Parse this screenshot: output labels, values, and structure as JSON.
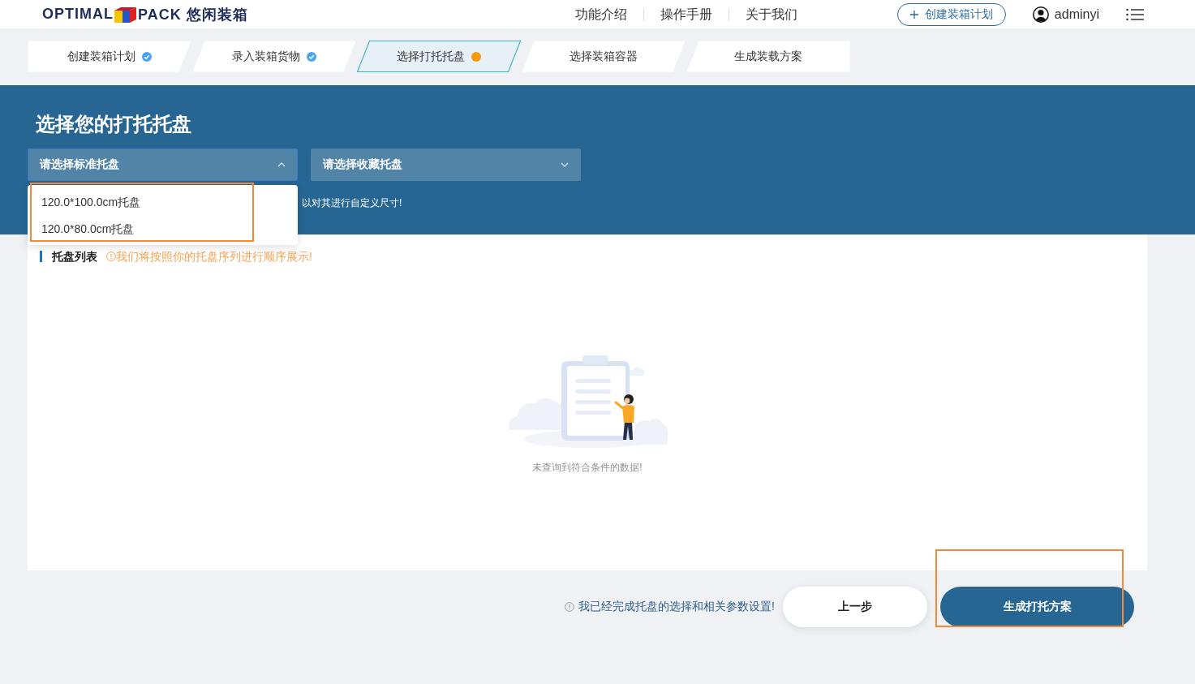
{
  "header": {
    "logo": {
      "left": "OPTIMAL",
      "right": "PACK",
      "name": "悠闲装箱"
    },
    "nav": [
      {
        "label": "功能介绍"
      },
      {
        "label": "操作手册"
      },
      {
        "label": "关于我们"
      }
    ],
    "create_button": "创建装箱计划",
    "user": "adminyi"
  },
  "steps": [
    {
      "label": "创建装箱计划",
      "done": true,
      "current": false,
      "selected": false
    },
    {
      "label": "录入装箱货物",
      "done": true,
      "current": false,
      "selected": false
    },
    {
      "label": "选择打托托盘",
      "done": false,
      "current": true,
      "selected": true
    },
    {
      "label": "选择装箱容器",
      "done": false,
      "current": false,
      "selected": false
    },
    {
      "label": "生成装载方案",
      "done": false,
      "current": false,
      "selected": false
    }
  ],
  "panel": {
    "title": "选择您的打托托盘",
    "selects": [
      {
        "placeholder": "请选择标准托盘",
        "expanded": true,
        "options": [
          {
            "label": "120.0*100.0cm托盘"
          },
          {
            "label": "120.0*80.0cm托盘"
          }
        ],
        "menu_highlighted": true
      },
      {
        "placeholder": "请选择收藏托盘",
        "expanded": false
      }
    ],
    "hint": "以对其进行自定义尺寸!"
  },
  "list": {
    "title": "托盘列表",
    "note": "我们将按照你的托盘序列进行顺序展示!",
    "empty_text": "未查询到符合条件的数据!"
  },
  "footer": {
    "note": "我已经完成托盘的选择和相关参数设置!",
    "buttons": [
      {
        "label": "上一步",
        "kind": "secondary",
        "highlighted": false
      },
      {
        "label": "生成打托方案",
        "kind": "primary",
        "highlighted": true
      }
    ]
  }
}
